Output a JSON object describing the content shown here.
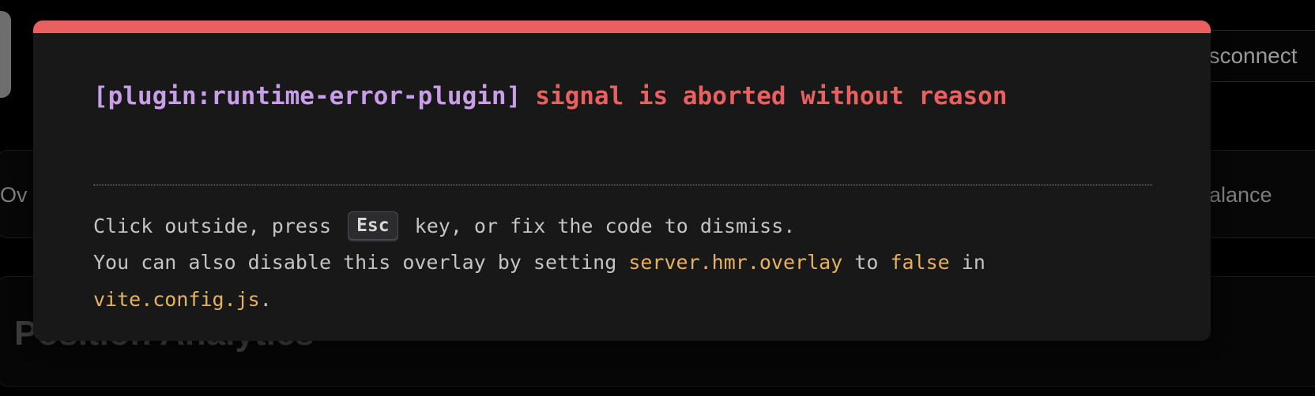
{
  "background": {
    "disconnect_label": "Disconnect",
    "tab_left_label": "Ov",
    "tab_right_label": "alance",
    "card_title": "Position Analytics"
  },
  "overlay": {
    "plugin": "[plugin:runtime-error-plugin]",
    "message": "signal is aborted without reason",
    "tip": {
      "line1_before": "Click outside, press ",
      "key": "Esc",
      "line1_after": " key, or fix the code to dismiss.",
      "line2_before": "You can also disable this overlay by setting ",
      "setting": "server.hmr.overlay",
      "line2_mid": " to ",
      "value": "false",
      "line2_after": " in",
      "config_file": "vite.config.js",
      "line3_after": "."
    }
  },
  "colors": {
    "accent_red": "#e8605f",
    "plugin_purple": "#c99ee8",
    "code_yellow": "#e7b25f"
  }
}
